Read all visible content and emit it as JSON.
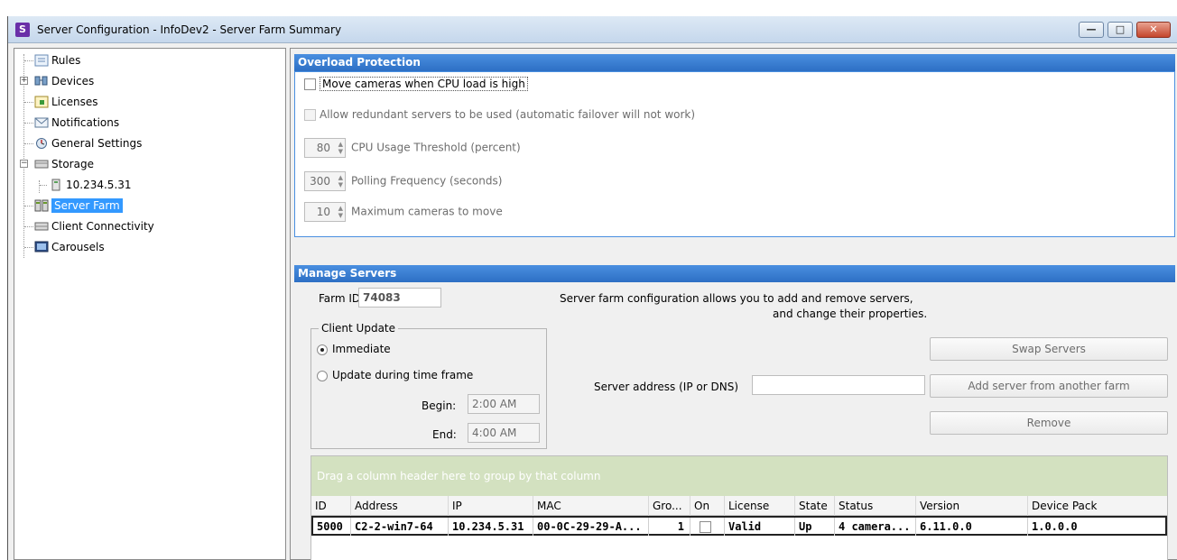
{
  "window": {
    "app_icon": "S",
    "title": "Server Configuration - InfoDev2 - Server Farm Summary",
    "minimize_symbol": "—",
    "maximize_symbol": "□",
    "close_symbol": "✕"
  },
  "tree": {
    "items": [
      {
        "label": "Rules",
        "icon": "rules-icon"
      },
      {
        "label": "Devices",
        "icon": "devices-icon"
      },
      {
        "label": "Licenses",
        "icon": "licenses-icon"
      },
      {
        "label": "Notifications",
        "icon": "notifications-icon"
      },
      {
        "label": "General Settings",
        "icon": "general-settings-icon"
      },
      {
        "label": "Storage",
        "icon": "storage-icon"
      },
      {
        "label": "10.234.5.31",
        "icon": "server-storage-icon"
      },
      {
        "label": "Server Farm",
        "icon": "server-farm-icon"
      },
      {
        "label": "Client Connectivity",
        "icon": "client-connectivity-icon"
      },
      {
        "label": "Carousels",
        "icon": "carousels-icon"
      }
    ],
    "selected": "Server Farm"
  },
  "overload": {
    "header": "Overload Protection",
    "move_cameras_label": "Move cameras when CPU load is high",
    "move_cameras_checked": false,
    "redundant_label": "Allow redundant servers to be used (automatic failover will not work)",
    "redundant_checked": false,
    "cpu_threshold_value": "80",
    "cpu_threshold_label": "CPU Usage Threshold (percent)",
    "polling_value": "300",
    "polling_label": "Polling Frequency (seconds)",
    "max_cameras_value": "10",
    "max_cameras_label": "Maximum cameras to move"
  },
  "manage": {
    "header": "Manage Servers",
    "farm_id_label": "Farm ID",
    "farm_id_value": "74083",
    "description_line1": "Server farm configuration allows you to add and remove servers,",
    "description_line2": "and change their properties.",
    "client_update_label": "Client Update",
    "immediate_label": "Immediate",
    "timeframe_label": "Update during time frame",
    "selected_update": "Immediate",
    "begin_label": "Begin:",
    "begin_value": "2:00 AM",
    "end_label": "End:",
    "end_value": "4:00 AM",
    "server_address_label": "Server address (IP or DNS)",
    "server_address_value": "",
    "swap_button": "Swap Servers",
    "add_button": "Add server from another farm",
    "remove_button": "Remove"
  },
  "grid": {
    "group_hint": "Drag a column header here to group by that column",
    "columns": [
      "ID",
      "Address",
      "IP",
      "MAC",
      "Gro...",
      "On",
      "License",
      "State",
      "Status",
      "Version",
      "Device Pack"
    ],
    "rows": [
      {
        "id": "5000",
        "address": "C2-2-win7-64",
        "ip": "10.234.5.31",
        "mac": "00-0C-29-29-A...",
        "group": "1",
        "on": false,
        "license": "Valid",
        "state": "Up",
        "status": "4 camera...",
        "version": "6.11.0.0",
        "device_pack": "1.0.0.0"
      }
    ]
  },
  "colors": {
    "section_header": "#2d6fc4",
    "selection": "#3399ff",
    "group_bar": "#d3e1c0"
  }
}
